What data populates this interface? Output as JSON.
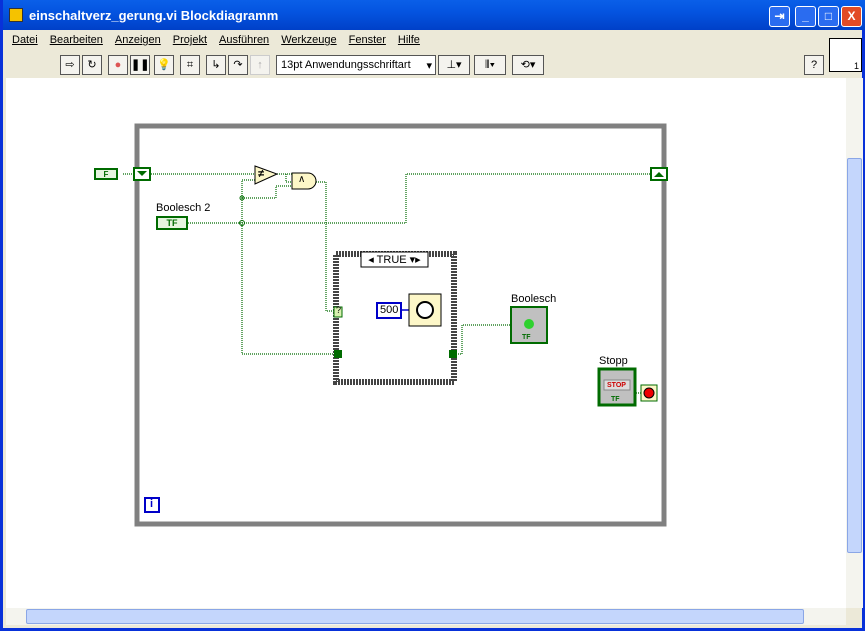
{
  "window": {
    "title": "einschaltverz_gerung.vi Blockdiagramm"
  },
  "menu": [
    "Datei",
    "Bearbeiten",
    "Anzeigen",
    "Projekt",
    "Ausführen",
    "Werkzeuge",
    "Fenster",
    "Hilfe"
  ],
  "toolbar": {
    "font": "13pt Anwendungsschriftart",
    "help": "?"
  },
  "vi_icon": {
    "connector_number": "1"
  },
  "diagram": {
    "boolesch2_label": "Boolesch 2",
    "boolesch_label": "Boolesch",
    "stopp_label": "Stopp",
    "case_selector": "TRUE",
    "wait_constant": "500",
    "loop_iteration": "i",
    "shift_register_constant": "F",
    "tf": "TF",
    "stop_text": "STOP",
    "case_terminal": "?",
    "not_equal": "≠",
    "and": "∧"
  },
  "colors": {
    "bool_wire": "#006b00",
    "loop": "#808080",
    "numeric": "#0000c8"
  }
}
